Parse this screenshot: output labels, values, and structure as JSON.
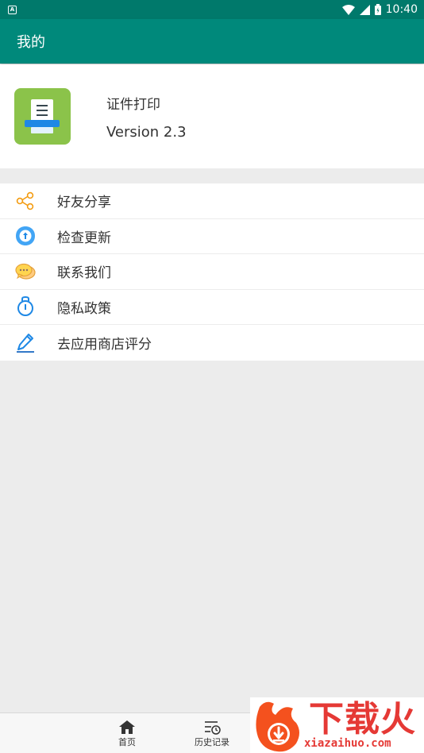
{
  "status_bar": {
    "time": "10:40",
    "notification_icon": "notification-a-icon",
    "icons": [
      "wifi-icon",
      "signal-icon",
      "battery-icon"
    ]
  },
  "app_bar": {
    "title": "我的"
  },
  "profile": {
    "app_name": "证件打印",
    "version": "Version 2.3",
    "logo_icon": "printer-icon"
  },
  "menu": {
    "items": [
      {
        "label": "好友分享",
        "icon": "share-icon"
      },
      {
        "label": "检查更新",
        "icon": "update-icon"
      },
      {
        "label": "联系我们",
        "icon": "chat-icon"
      },
      {
        "label": "隐私政策",
        "icon": "privacy-icon"
      },
      {
        "label": "去应用商店评分",
        "icon": "pen-icon"
      }
    ]
  },
  "bottom_nav": {
    "items": [
      {
        "label": "首页",
        "icon": "home-icon"
      },
      {
        "label": "历史记录",
        "icon": "history-icon"
      }
    ]
  },
  "watermark": {
    "brand": "下载火",
    "url": "xiazaihuo.com"
  },
  "colors": {
    "primary": "#00897b",
    "primary_dark": "#00796b",
    "logo_bg": "#8bc34a",
    "watermark": "#e53935"
  }
}
